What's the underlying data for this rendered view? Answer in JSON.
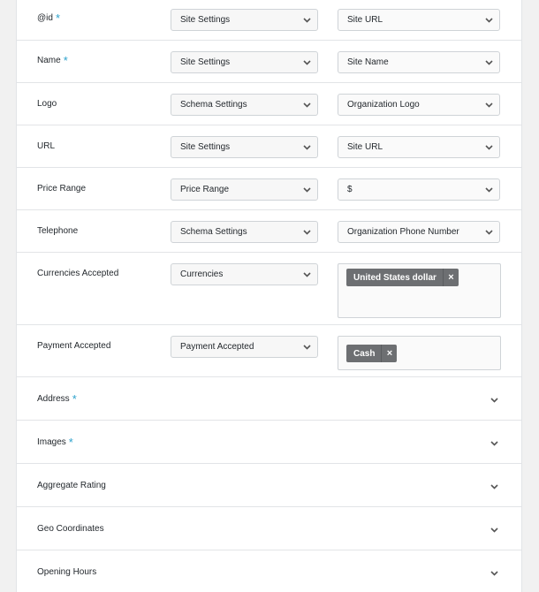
{
  "fields": [
    {
      "label": "@id",
      "required": true,
      "source": "Site Settings",
      "value": "Site URL"
    },
    {
      "label": "Name",
      "required": true,
      "source": "Site Settings",
      "value": "Site Name"
    },
    {
      "label": "Logo",
      "required": false,
      "source": "Schema Settings",
      "value": "Organization Logo"
    },
    {
      "label": "URL",
      "required": false,
      "source": "Site Settings",
      "value": "Site URL"
    },
    {
      "label": "Price Range",
      "required": false,
      "source": "Price Range",
      "value": "$"
    },
    {
      "label": "Telephone",
      "required": false,
      "source": "Schema Settings",
      "value": "Organization Phone Number"
    }
  ],
  "currencies": {
    "label": "Currencies Accepted",
    "source": "Currencies",
    "tag": "United States dollar",
    "tag_remove": "×"
  },
  "payment": {
    "label": "Payment Accepted",
    "source": "Payment Accepted",
    "tag": "Cash",
    "tag_remove": "×"
  },
  "required_marker": "*",
  "sections": [
    {
      "label": "Address",
      "required": true
    },
    {
      "label": "Images",
      "required": true
    },
    {
      "label": "Aggregate Rating",
      "required": false
    },
    {
      "label": "Geo Coordinates",
      "required": false
    },
    {
      "label": "Opening Hours",
      "required": false
    }
  ],
  "icons": {
    "dropdown": "chevron-down-icon",
    "remove": "close-icon"
  }
}
